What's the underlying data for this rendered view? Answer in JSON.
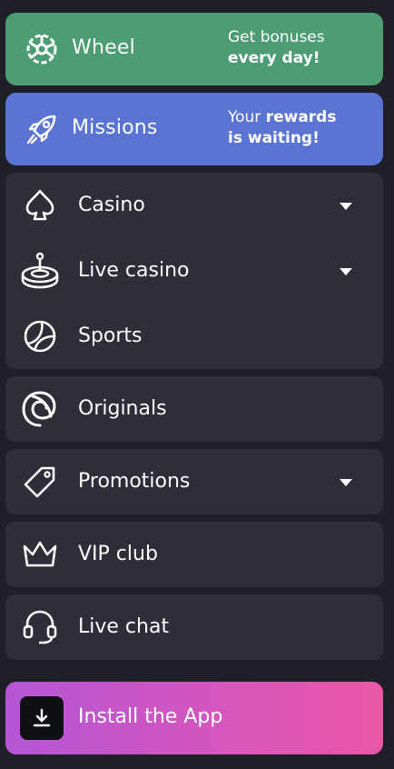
{
  "promos": {
    "wheel": {
      "title": "Wheel",
      "tag_line1": "Get bonuses",
      "tag_line2": "every day!",
      "icon": "wheel-icon",
      "color": "#4c9c74"
    },
    "missions": {
      "title": "Missions",
      "tag_line1_pre": "Your ",
      "tag_line1_bold": "rewards",
      "tag_line2": "is waiting!",
      "icon": "rocket-icon",
      "color": "#5a74d4"
    }
  },
  "menu": {
    "casino": {
      "label": "Casino",
      "icon": "spade-icon",
      "expandable": true
    },
    "live_casino": {
      "label": "Live casino",
      "icon": "roulette-icon",
      "expandable": true
    },
    "sports": {
      "label": "Sports",
      "icon": "tennis-ball-icon",
      "expandable": false
    },
    "originals": {
      "label": "Originals",
      "icon": "spiral-icon",
      "expandable": false
    },
    "promotions": {
      "label": "Promotions",
      "icon": "tag-icon",
      "expandable": true
    },
    "vip_club": {
      "label": "VIP club",
      "icon": "crown-icon",
      "expandable": false
    },
    "live_chat": {
      "label": "Live chat",
      "icon": "headset-icon",
      "expandable": false
    }
  },
  "install": {
    "label": "Install the App",
    "icon": "download-icon"
  },
  "colors": {
    "background": "#1e1f27",
    "panel": "#2d2e38"
  }
}
